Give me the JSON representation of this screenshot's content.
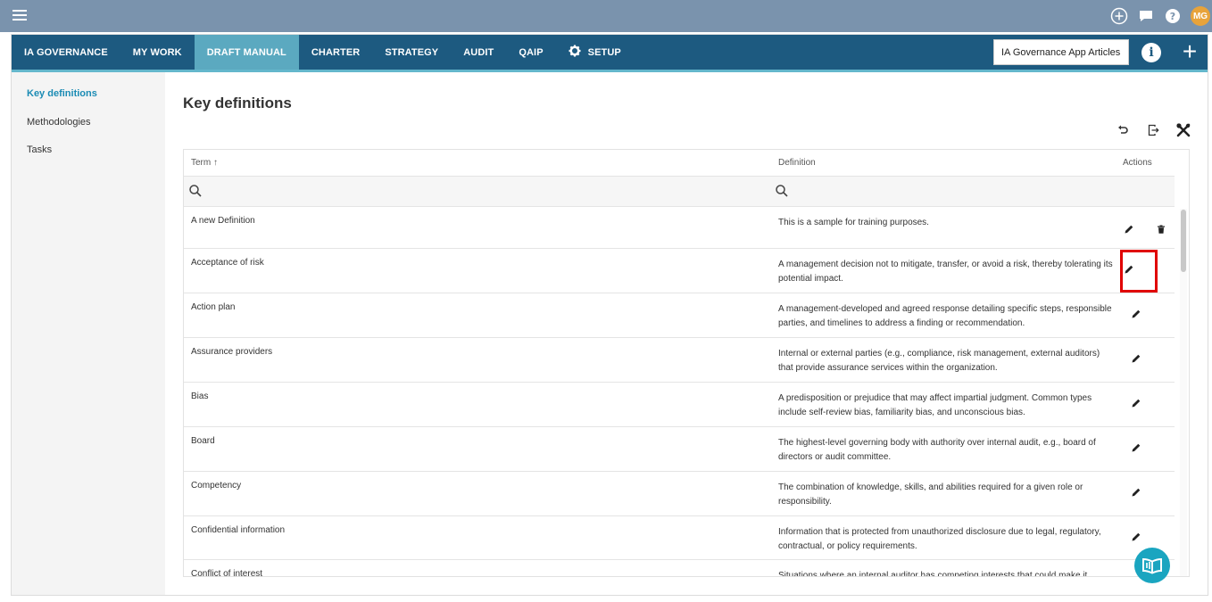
{
  "topbar": {
    "avatar_initials": "MG",
    "icons": [
      "menu-icon",
      "add-circle-icon",
      "chat-icon",
      "help-icon"
    ]
  },
  "navbar": {
    "tabs": [
      {
        "label": "IA GOVERNANCE",
        "active": false
      },
      {
        "label": "MY WORK",
        "active": false
      },
      {
        "label": "DRAFT MANUAL",
        "active": true
      },
      {
        "label": "CHARTER",
        "active": false
      },
      {
        "label": "STRATEGY",
        "active": false
      },
      {
        "label": "AUDIT",
        "active": false
      },
      {
        "label": "QAIP",
        "active": false
      },
      {
        "label": "SETUP",
        "active": false
      }
    ],
    "search_value": "IA Governance App Articles"
  },
  "sidebar": {
    "items": [
      "Key definitions",
      "Methodologies",
      "Tasks"
    ],
    "active": "Key definitions"
  },
  "main": {
    "title": "Key definitions",
    "table": {
      "columns": [
        "Term ↑",
        "Definition",
        "Actions"
      ],
      "rows": [
        {
          "term": "A new Definition",
          "definition": "This is a sample for training purposes.",
          "deletable": true
        },
        {
          "term": "Acceptance of risk",
          "definition": "A management decision not to mitigate, transfer, or avoid a risk, thereby tolerating its potential impact.",
          "deletable": false
        },
        {
          "term": "Action plan",
          "definition": "A management-developed and agreed response detailing specific steps, responsible parties, and timelines to address a finding or recommendation.",
          "deletable": false
        },
        {
          "term": "Assurance providers",
          "definition": "Internal or external parties (e.g., compliance, risk management, external auditors) that provide assurance services within the organization.",
          "deletable": false
        },
        {
          "term": "Bias",
          "definition": "A predisposition or prejudice that may affect impartial judgment. Common types include self-review bias, familiarity bias, and unconscious bias.",
          "deletable": false
        },
        {
          "term": "Board",
          "definition": "The highest-level governing body with authority over internal audit, e.g., board of directors or audit committee.",
          "deletable": false
        },
        {
          "term": "Competency",
          "definition": "The combination of knowledge, skills, and abilities required for a given role or responsibility.",
          "deletable": false
        },
        {
          "term": "Confidential information",
          "definition": "Information that is protected from unauthorized disclosure due to legal, regulatory, contractual, or policy requirements.",
          "deletable": false
        },
        {
          "term": "Conflict of interest",
          "definition": "Situations where an internal auditor has competing interests that could make it",
          "deletable": false
        }
      ]
    }
  },
  "colors": {
    "topbar": "#7a93ad",
    "navbar": "#1d5a80",
    "nav_active": "#5ba9c0",
    "sidebar_active_text": "#1a8bb4",
    "highlight": "#e00000",
    "fab": "#1aa5c0"
  }
}
